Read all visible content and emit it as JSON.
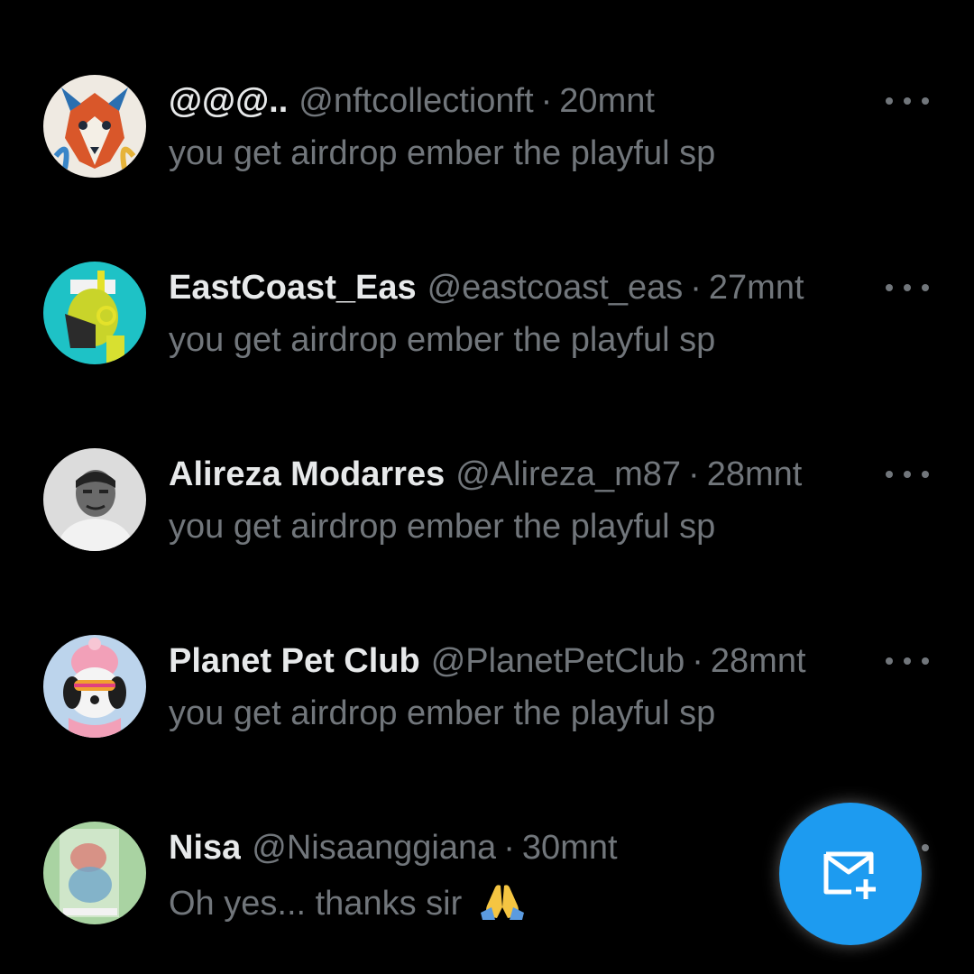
{
  "messages": [
    {
      "name": "@@@..",
      "handle": "@nftcollectionft",
      "separator": "·",
      "time": "20mnt",
      "preview": "you get airdrop ember the playful sp",
      "avatar_icon": "wolf-avatar-icon",
      "avatar_colors": [
        "#e8e4dc",
        "#d9572a",
        "#2a6fb0"
      ]
    },
    {
      "name": "EastCoast_Eas",
      "handle": "@eastcoast_eas",
      "separator": "·",
      "time": "27mnt",
      "preview": "you get airdrop ember the playful sp",
      "avatar_icon": "masked-character-avatar-icon",
      "avatar_colors": [
        "#1ec2c6",
        "#c9d42a",
        "#2b2b2b"
      ]
    },
    {
      "name": "Alireza Modarres",
      "handle": "@Alireza_m87",
      "separator": "·",
      "time": "28mnt",
      "preview": "you get airdrop ember the playful sp",
      "avatar_icon": "person-photo-avatar-icon",
      "avatar_colors": [
        "#d9d9d9",
        "#3a3a3a",
        "#f2f2f2"
      ]
    },
    {
      "name": "Planet Pet Club",
      "handle": "@PlanetPetClub",
      "separator": "·",
      "time": "28mnt",
      "preview": "you get airdrop ember the playful sp",
      "avatar_icon": "dog-with-beanie-avatar-icon",
      "avatar_colors": [
        "#bcd4ec",
        "#f2a0b8",
        "#1e1e1e"
      ]
    },
    {
      "name": "Nisa",
      "handle": "@Nisaanggiana",
      "separator": "·",
      "time": "30mnt",
      "preview": "Oh yes... thanks sir",
      "preview_emoji": "folded-hands-emoji",
      "avatar_icon": "blurred-image-avatar-icon",
      "avatar_colors": [
        "#a9d3a2",
        "#d8837a",
        "#6fa6c9"
      ]
    }
  ],
  "fab": {
    "icon": "new-message-envelope-plus-icon",
    "color": "#1d9bf0"
  },
  "colors": {
    "background": "#000000",
    "primary_text": "#e7e9ea",
    "secondary_text": "#71767b"
  }
}
